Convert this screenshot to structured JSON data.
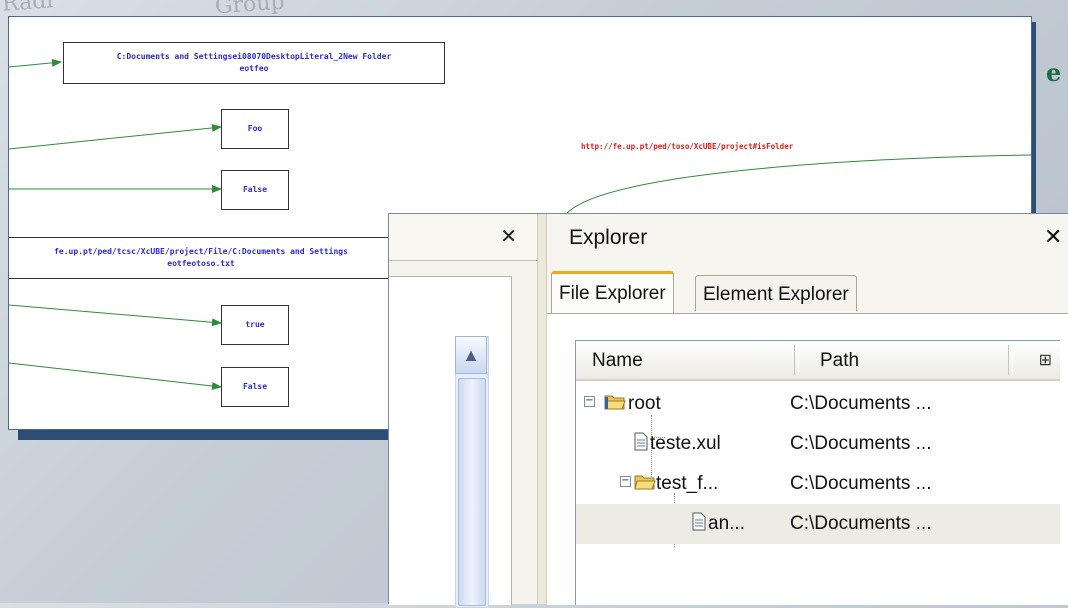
{
  "background": {
    "top_left_text": "Radi",
    "top_group_text": "Group",
    "right_fragment": "e"
  },
  "graph": {
    "nodes": {
      "folder_path": "C:Documents and Settingsei08070DesktopLiteral_2New Folder",
      "folder_sub": "eotfeo",
      "foo": "Foo",
      "false1": "False",
      "file_path": "fe.up.pt/ped/tcsc/XcUBE/project/File/C:Documents and Settings",
      "file_sub": "eotfeotoso.txt",
      "true": "true",
      "false2": "False"
    },
    "edge_label": "http://fe.up.pt/ped/toso/XcUBE/project#isFolder"
  },
  "left_panel": {
    "close": "✕",
    "scroll_up": "▲"
  },
  "explorer": {
    "title": "Explorer",
    "close": "✕",
    "tabs": [
      {
        "label": "File Explorer",
        "active": true
      },
      {
        "label": "Element Explorer",
        "active": false
      }
    ],
    "columns": {
      "name": "Name",
      "path": "Path",
      "picker": "⊞"
    },
    "rows": [
      {
        "name": "root",
        "path": "C:\\Documents ...",
        "type": "folder",
        "level": 0,
        "expander": "−"
      },
      {
        "name": "teste.xul",
        "path": "C:\\Documents ...",
        "type": "file",
        "level": 1
      },
      {
        "name": "test_f...",
        "path": "C:\\Documents ...",
        "type": "folder",
        "level": 1,
        "expander": "−"
      },
      {
        "name": "an...",
        "path": "C:\\Documents ...",
        "type": "file",
        "level": 2,
        "selected": true
      }
    ]
  },
  "colors": {
    "node_text": "#2b2bd6",
    "edge": "#2e8b3a",
    "edge_label": "#e01b1b",
    "tab_accent": "#f5a520"
  }
}
